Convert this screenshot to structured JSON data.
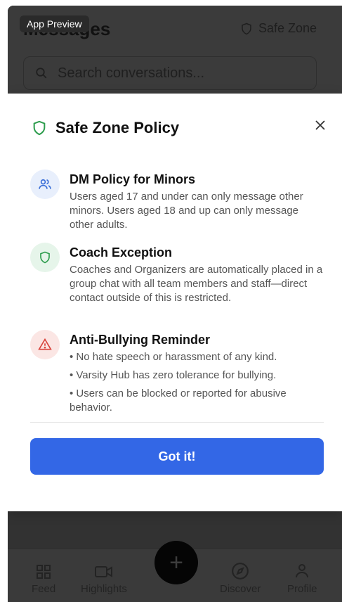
{
  "badge": "App Preview",
  "background": {
    "title": "Messages",
    "safe_zone_label": "Safe Zone",
    "search_placeholder": "Search conversations..."
  },
  "modal": {
    "title": "Safe Zone Policy",
    "sections": [
      {
        "icon": "users-icon",
        "heading": "DM Policy for Minors",
        "body": "Users aged 17 and under can only message other minors. Users aged 18 and up can only message other adults."
      },
      {
        "icon": "shield-icon",
        "heading": "Coach Exception",
        "body": "Coaches and Organizers are automatically placed in a group chat with all team members and staff—direct contact outside of this is restricted."
      },
      {
        "icon": "alert-triangle-icon",
        "heading": "Anti-Bullying Reminder",
        "bullets": [
          "• No hate speech or harassment of any kind.",
          "• Varsity Hub has zero tolerance for bullying.",
          "• Users can be blocked or reported for abusive behavior."
        ]
      }
    ],
    "button_label": "Got it!"
  },
  "nav": {
    "feed": "Feed",
    "highlights": "Highlights",
    "add": "+",
    "discover": "Discover",
    "profile": "Profile"
  },
  "colors": {
    "primary": "#3367e6",
    "green": "#2e9d4e",
    "blue": "#3b6fd8",
    "red": "#d9433b"
  }
}
